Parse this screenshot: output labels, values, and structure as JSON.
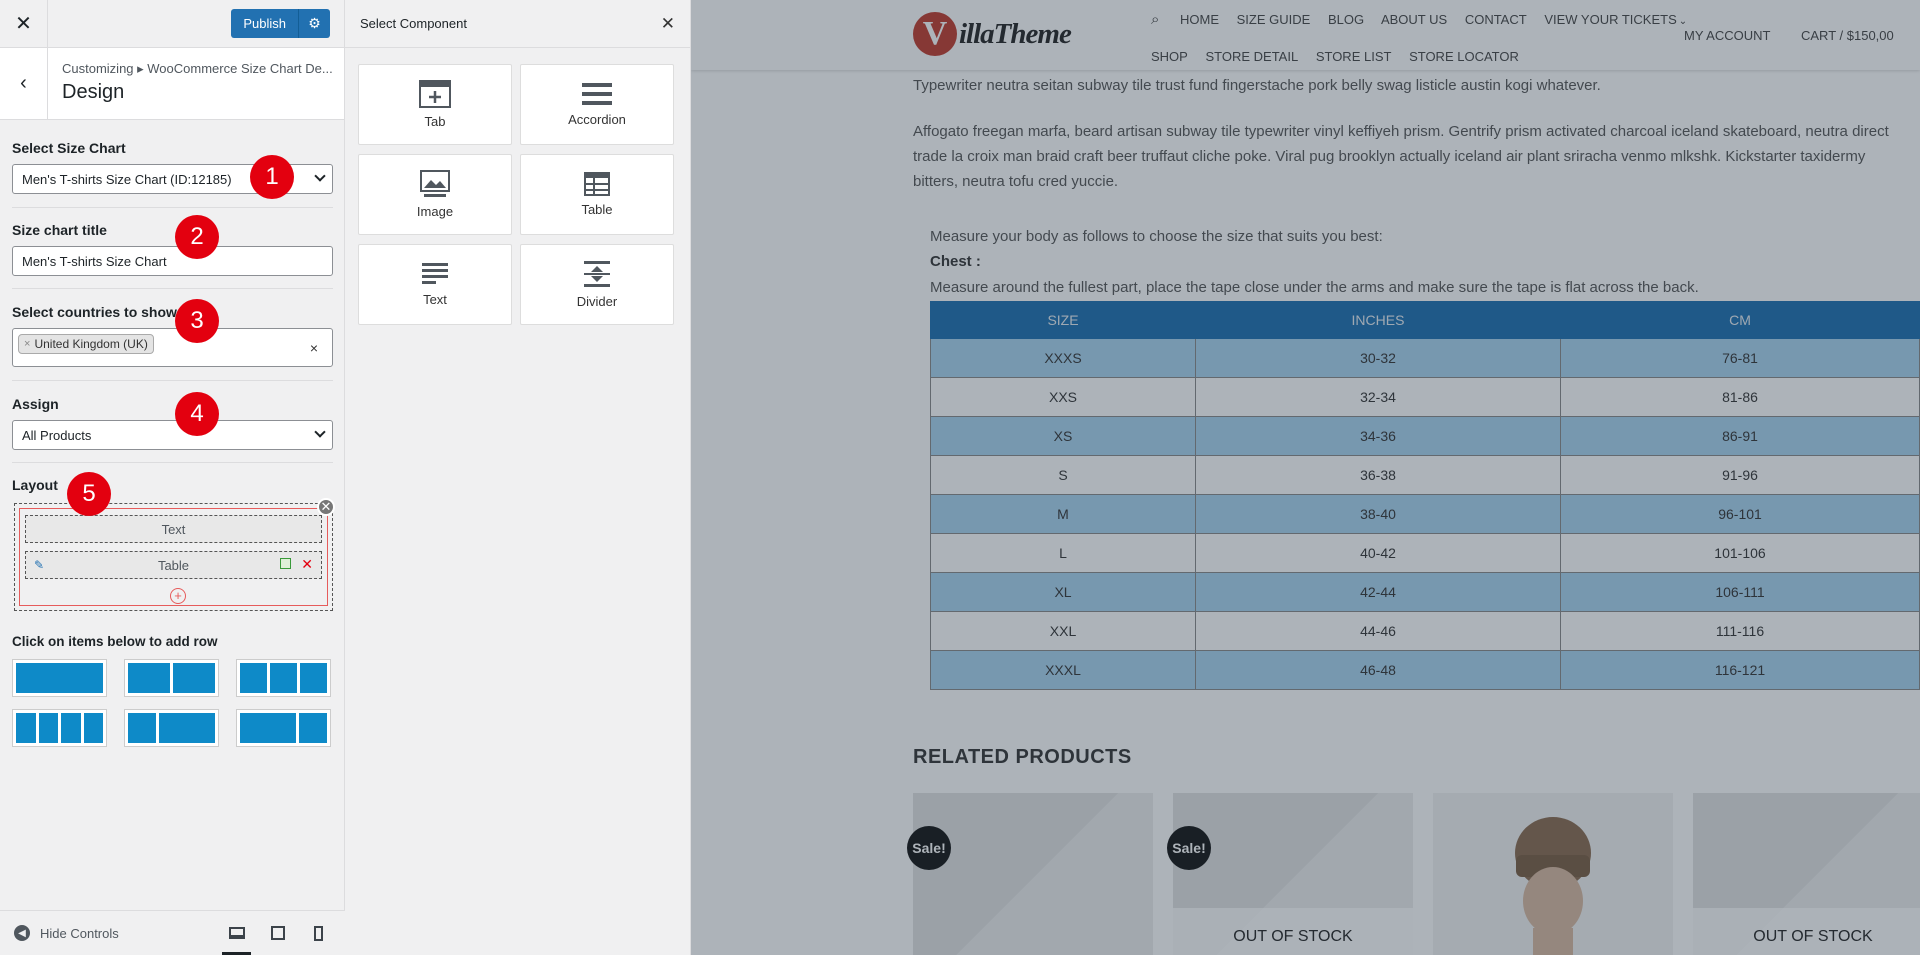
{
  "sidebar": {
    "publish_label": "Publish",
    "breadcrumb": "Customizing ▸ WooCommerce Size Chart De...",
    "section_title": "Design",
    "select_chart_label": "Select Size Chart",
    "select_chart_value": "Men's T-shirts Size Chart (ID:12185)",
    "title_label": "Size chart title",
    "title_value": "Men's T-shirts Size Chart",
    "countries_label": "Select countries to show",
    "country_tag": "United Kingdom (UK)",
    "assign_label": "Assign",
    "assign_value": "All Products",
    "layout_label": "Layout",
    "layout_rows": [
      "Text",
      "Table"
    ],
    "add_row_label": "Click on items below to add row",
    "hide_controls": "Hide Controls",
    "badges": [
      "1",
      "2",
      "3",
      "4",
      "5"
    ]
  },
  "components": {
    "title": "Select Component",
    "items": [
      "Tab",
      "Accordion",
      "Image",
      "Table",
      "Text",
      "Divider"
    ]
  },
  "preview": {
    "nav_row1": [
      "HOME",
      "SIZE GUIDE",
      "BLOG",
      "ABOUT US",
      "CONTACT",
      "VIEW YOUR TICKETS"
    ],
    "nav_row2": [
      "SHOP",
      "STORE DETAIL",
      "STORE LIST",
      "STORE LOCATOR"
    ],
    "my_account": "MY ACCOUNT",
    "cart": "CART / $150,00",
    "logo_text": "illaTheme",
    "para1": "Typewriter neutra seitan subway tile trust fund fingerstache pork belly swag listicle austin kogi whatever.",
    "para2": "Affogato freegan marfa, beard artisan subway tile typewriter vinyl keffiyeh prism. Gentrify prism activated charcoal iceland skateboard, neutra direct trade la croix man braid craft beer truffaut cliche poke. Viral pug brooklyn actually iceland air plant sriracha venmo mlkshk. Kickstarter taxidermy bitters, neutra tofu cred yuccie.",
    "measure_intro": "Measure your body as follows to choose the size that suits you best:",
    "chest_label": "Chest :",
    "chest_desc": "Measure around the fullest part, place the tape close under the arms and make sure the tape is flat across the back.",
    "table_headers": [
      "SIZE",
      "INCHES",
      "CM"
    ],
    "table_rows": [
      [
        "XXXS",
        "30-32",
        "76-81"
      ],
      [
        "XXS",
        "32-34",
        "81-86"
      ],
      [
        "XS",
        "34-36",
        "86-91"
      ],
      [
        "S",
        "36-38",
        "91-96"
      ],
      [
        "M",
        "38-40",
        "96-101"
      ],
      [
        "L",
        "40-42",
        "101-106"
      ],
      [
        "XL",
        "42-44",
        "106-111"
      ],
      [
        "XXL",
        "44-46",
        "111-116"
      ],
      [
        "XXXL",
        "46-48",
        "116-121"
      ]
    ],
    "related_title": "RELATED PRODUCTS",
    "sale_label": "Sale!",
    "out_of_stock": "OUT OF STOCK"
  },
  "colors": {
    "accent": "#2271b1",
    "badge": "#e3000f",
    "table_header": "#1a6fb0",
    "table_stripe": "#a9d3ef",
    "row_template": "#0e8ac8"
  }
}
